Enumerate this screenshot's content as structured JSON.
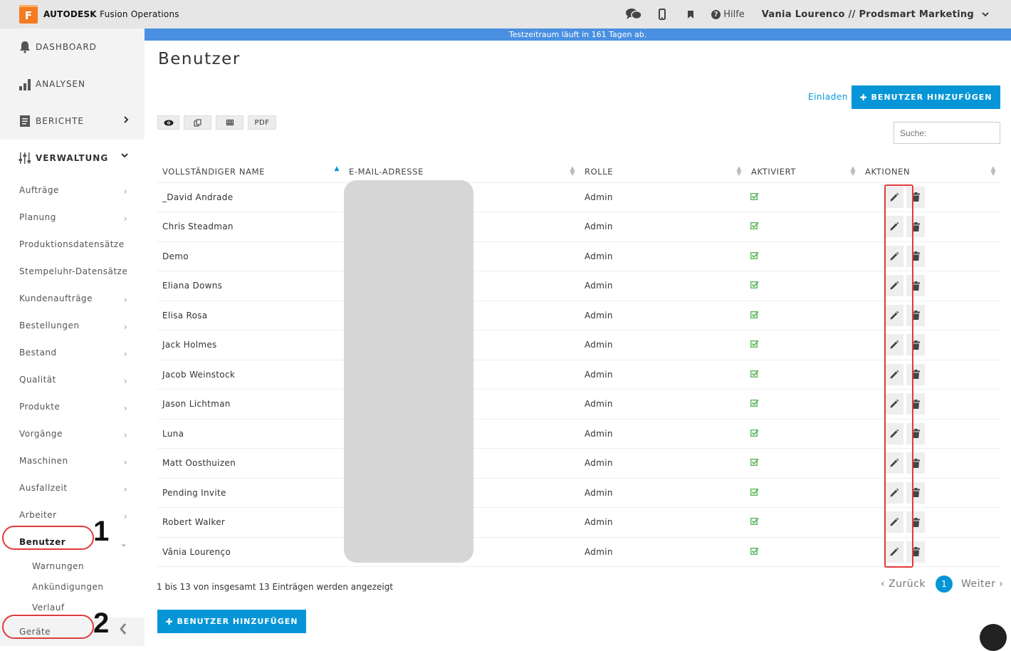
{
  "topbar": {
    "logo_letter": "F",
    "brand": "AUTODESK",
    "product": "Fusion Operations",
    "help_label": "Hilfe",
    "user_label": "Vania Lourenco // Prodsmart Marketing"
  },
  "trial_banner": "Testzeitraum läuft in 161 Tagen ab.",
  "sidebar": {
    "main": [
      {
        "label": "DASHBOARD",
        "icon": "bell-icon"
      },
      {
        "label": "ANALYSEN",
        "icon": "bar-chart-icon"
      },
      {
        "label": "BERICHTE",
        "icon": "document-icon"
      },
      {
        "label": "VERWALTUNG",
        "icon": "sliders-icon"
      }
    ],
    "admin_items": [
      "Aufträge",
      "Planung",
      "Produktionsdatensätze",
      "Stempeluhr-Datensätze",
      "Kundenaufträge",
      "Bestellungen",
      "Bestand",
      "Qualität",
      "Produkte",
      "Vorgänge",
      "Maschinen",
      "Ausfallzeit",
      "Arbeiter",
      "Benutzer"
    ],
    "user_sub": [
      "Warnungen",
      "Ankündigungen",
      "Verlauf"
    ],
    "devices": "Geräte"
  },
  "page": {
    "title": "Benutzer",
    "invite_label": "Einladen",
    "add_user_label": "BENUTZER HINZUFÜGEN",
    "export_pdf": "PDF",
    "search_placeholder": "Suche:"
  },
  "table": {
    "headers": [
      "VOLLSTÄNDIGER NAME",
      "E-MAIL-ADRESSE",
      "ROLLE",
      "AKTIVIERT",
      "AKTIONEN"
    ],
    "rows": [
      {
        "name": "_David Andrade",
        "role": "Admin"
      },
      {
        "name": "Chris Steadman",
        "role": "Admin"
      },
      {
        "name": "Demo",
        "role": "Admin"
      },
      {
        "name": "Eliana Downs",
        "role": "Admin"
      },
      {
        "name": "Elisa Rosa",
        "role": "Admin"
      },
      {
        "name": "Jack Holmes",
        "role": "Admin"
      },
      {
        "name": "Jacob Weinstock",
        "role": "Admin"
      },
      {
        "name": "Jason Lichtman",
        "role": "Admin"
      },
      {
        "name": "Luna",
        "role": "Admin"
      },
      {
        "name": "Matt Oosthuizen",
        "role": "Admin"
      },
      {
        "name": "Pending Invite",
        "role": "Admin"
      },
      {
        "name": "Robert Walker",
        "role": "Admin"
      },
      {
        "name": "Vânia Lourenço",
        "role": "Admin"
      }
    ]
  },
  "footer": {
    "info": "1 bis 13 von insgesamt 13 Einträgen werden angezeigt",
    "prev": "‹ Zurück",
    "page": "1",
    "next": "Weiter ›"
  },
  "annotations": {
    "one": "1",
    "two": "2"
  },
  "colors": {
    "accent": "#0696d7",
    "banner": "#4a90e2",
    "annotation": "#e03a3a",
    "check": "#5cb85c"
  }
}
